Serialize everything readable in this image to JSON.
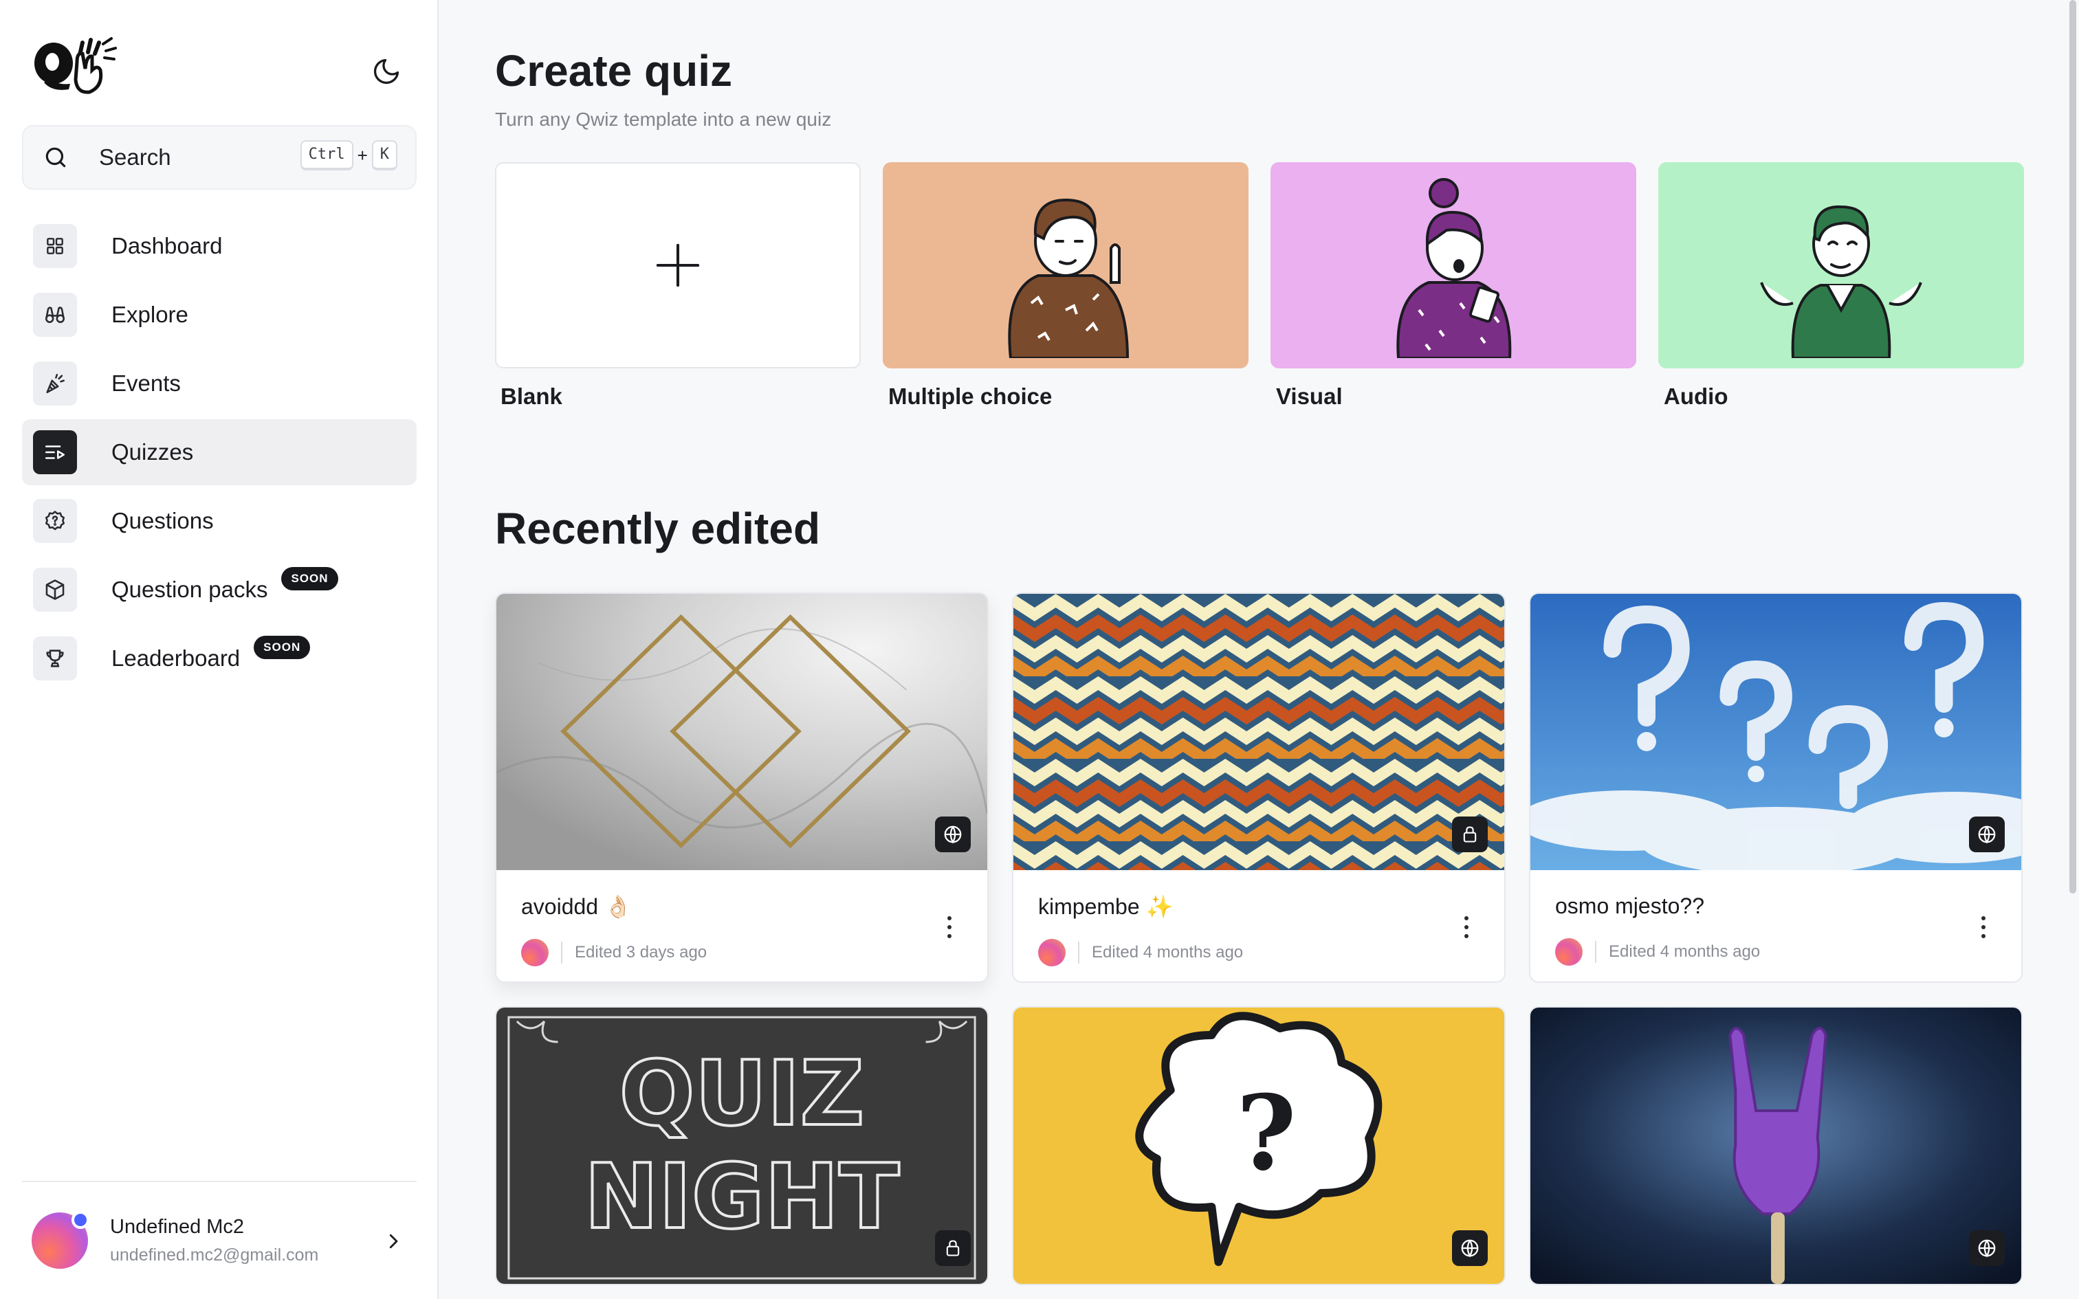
{
  "sidebar": {
    "search": {
      "label": "Search",
      "shortcut_mod": "Ctrl",
      "shortcut_plus": "+",
      "shortcut_key": "K",
      "icon": "search-icon"
    },
    "items": [
      {
        "label": "Dashboard",
        "icon": "dashboard-grid-icon",
        "active": false
      },
      {
        "label": "Explore",
        "icon": "binoculars-icon",
        "active": false
      },
      {
        "label": "Events",
        "icon": "party-popper-icon",
        "active": false
      },
      {
        "label": "Quizzes",
        "icon": "quiz-list-icon",
        "active": true
      },
      {
        "label": "Questions",
        "icon": "question-badge-icon",
        "active": false
      },
      {
        "label": "Question packs",
        "icon": "cube-icon",
        "active": false,
        "badge": "SOON"
      },
      {
        "label": "Leaderboard",
        "icon": "trophy-icon",
        "active": false,
        "badge": "SOON"
      }
    ],
    "user": {
      "name": "Undefined Mc2",
      "email": "undefined.mc2@gmail.com"
    }
  },
  "main": {
    "title": "Create quiz",
    "subtitle": "Turn any Qwiz template into a new quiz",
    "templates": [
      {
        "label": "Blank",
        "color": "#ffffff"
      },
      {
        "label": "Multiple choice",
        "color": "#ecb893"
      },
      {
        "label": "Visual",
        "color": "#eab0f0"
      },
      {
        "label": "Audio",
        "color": "#b5f1c7"
      }
    ],
    "recent_title": "Recently edited",
    "quizzes": [
      {
        "title": "avoiddd 👌🏻",
        "edited": "Edited 3 days ago",
        "visibility": "globe-icon"
      },
      {
        "title": "kimpembe ✨",
        "edited": "Edited 4 months ago",
        "visibility": "lock-icon"
      },
      {
        "title": "osmo mjesto??",
        "edited": "Edited 4 months ago",
        "visibility": "globe-icon"
      },
      {
        "title": "",
        "edited": "",
        "visibility": "lock-icon",
        "image_text": [
          "QUIZ",
          "NIGHT"
        ]
      },
      {
        "title": "",
        "edited": "",
        "visibility": "globe-icon",
        "image_text": [
          "?"
        ]
      },
      {
        "title": "",
        "edited": "",
        "visibility": "globe-icon"
      }
    ]
  },
  "colors": {
    "accent_dark": "#1f2125",
    "active_bg": "#efeff1",
    "notification_dot": "#4b60ff"
  }
}
